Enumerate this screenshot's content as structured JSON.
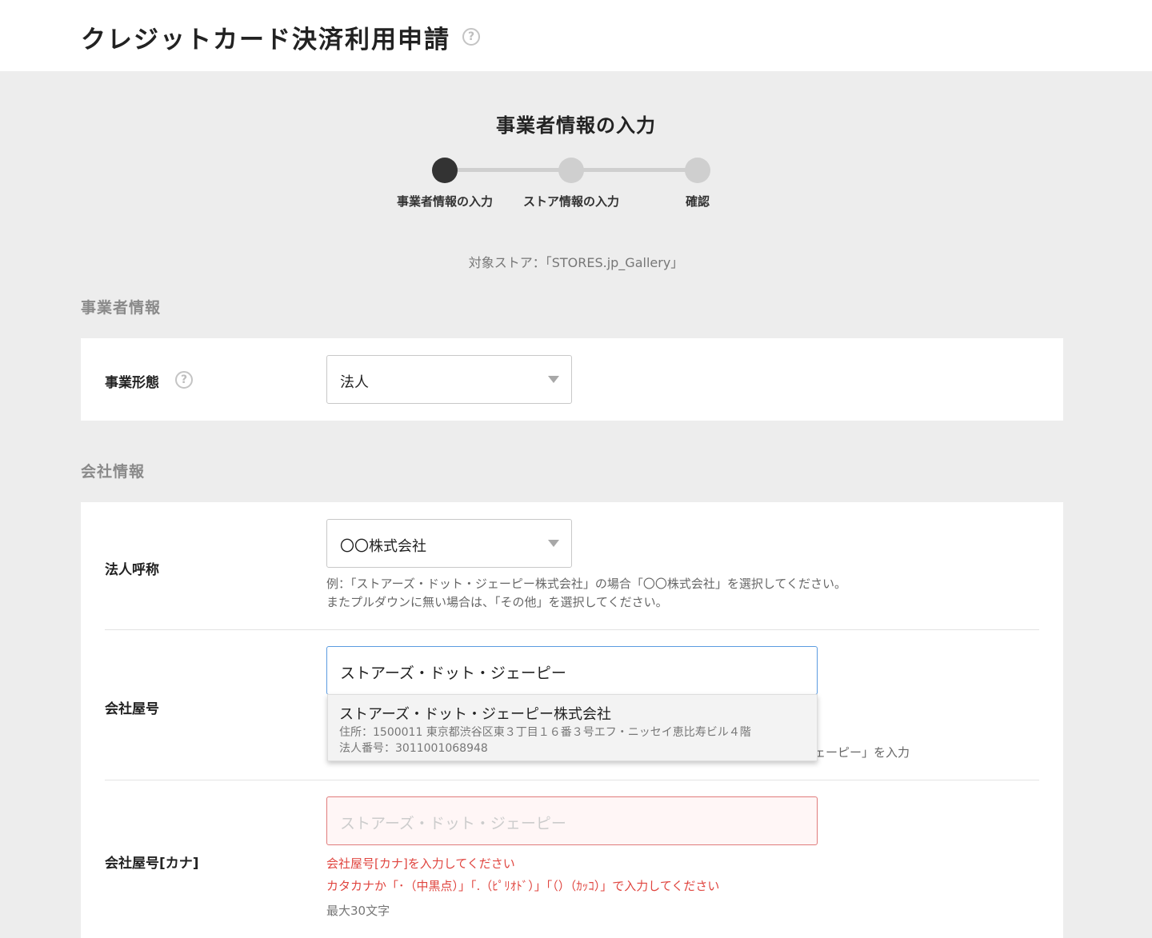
{
  "header": {
    "title": "クレジットカード決済利用申請",
    "help": "?"
  },
  "step": {
    "title": "事業者情報の入力",
    "steps": [
      {
        "label": "事業者情報の入力",
        "active": true
      },
      {
        "label": "ストア情報の入力",
        "active": false
      },
      {
        "label": "確認",
        "active": false
      }
    ]
  },
  "target_store": "対象ストア：「STORES.jp_Gallery」",
  "business_section": {
    "heading": "事業者情報",
    "business_type": {
      "label": "事業形態",
      "help": "?",
      "value": "法人"
    }
  },
  "company_section": {
    "heading": "会社情報",
    "corporate_title": {
      "label": "法人呼称",
      "value": "〇〇株式会社",
      "hint_line1": "例：「ストアーズ・ドット・ジェーピー株式会社」の場合「〇〇株式会社」を選択してください。",
      "hint_line2": "またプルダウンに無い場合は、「その他」を選択してください。"
    },
    "company_name": {
      "label": "会社屋号",
      "value": "ストアーズ・ドット・ジェーピー",
      "hint_tail": "ェーピー」を入力",
      "suggestion": {
        "name": "ストアーズ・ドット・ジェーピー株式会社",
        "address": "住所：1500011 東京都渋谷区東３丁目１６番３号エフ・ニッセイ恵比寿ビル４階",
        "corp_number": "法人番号：3011001068948"
      }
    },
    "company_kana": {
      "label": "会社屋号[カナ]",
      "placeholder": "ストアーズ・ドット・ジェーピー",
      "error1": "会社屋号[カナ]を入力してください",
      "error2": "カタカナか「･（中黒点）」「.（ﾋﾟﾘｵﾄﾞ）」「（）（ｶｯｺ）」で入力してください",
      "max_length": "最大30文字"
    }
  },
  "colors": {
    "background": "#ededed",
    "accent_dark": "#333333",
    "error": "#e0453f",
    "focus": "#5b9be0"
  }
}
